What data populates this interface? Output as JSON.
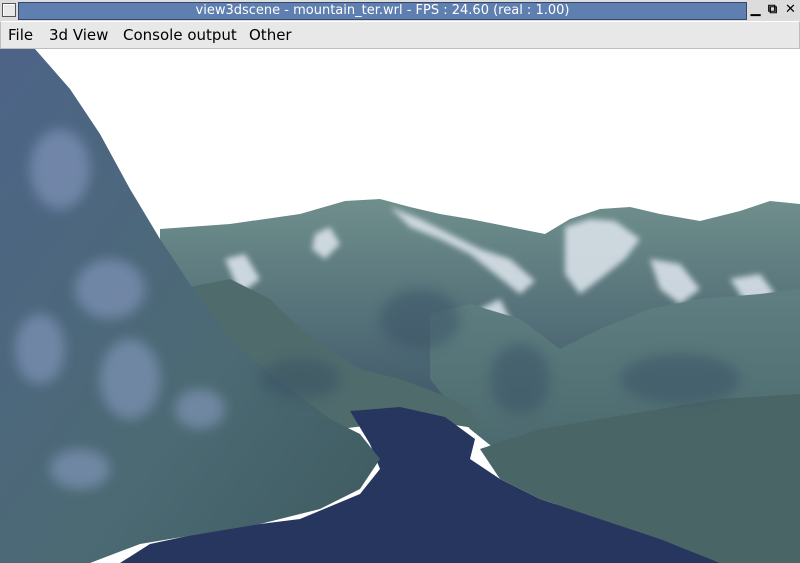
{
  "window": {
    "title": "view3dscene - mountain_ter.wrl - FPS : 24.60 (real : 1.00)",
    "minimize_glyph": "▁",
    "maximize_glyph": "⧉",
    "close_glyph": "✕"
  },
  "menubar": {
    "items": [
      "File",
      "3d View",
      "Console output",
      "Other"
    ]
  },
  "scene": {
    "description_icon": "3d-terrain-viewport",
    "colors": {
      "sky": "#ffffff",
      "mountain": "#4d6a73",
      "mountain_light": "#6f8f8c",
      "snow": "#dfe6ee",
      "shadow": "#344d63",
      "water": "#27365f"
    }
  }
}
